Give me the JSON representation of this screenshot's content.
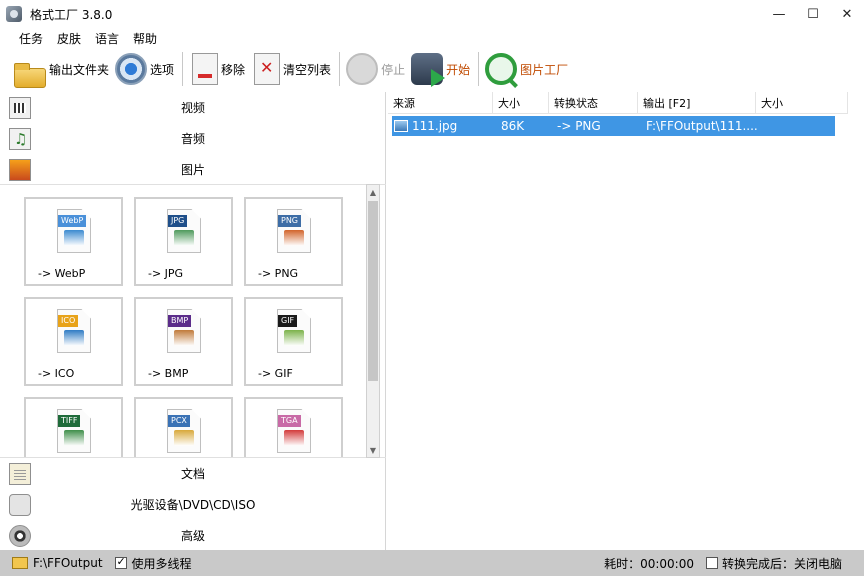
{
  "window": {
    "title": "格式工厂 3.8.0",
    "controls": {
      "minimize": "—",
      "maximize": "☐",
      "close": "✕"
    }
  },
  "menu": [
    "任务",
    "皮肤",
    "语言",
    "帮助"
  ],
  "toolbar": {
    "output_folder": "输出文件夹",
    "options": "选项",
    "remove": "移除",
    "clear_list": "清空列表",
    "stop": "停止",
    "start": "开始",
    "picture_factory": "图片工厂"
  },
  "categories": {
    "video": "视频",
    "audio": "音频",
    "picture": "图片",
    "document": "文档",
    "dvd": "光驱设备\\DVD\\CD\\ISO",
    "advanced": "高级"
  },
  "picture_tiles": [
    {
      "label": "-> WebP",
      "badge": "WebP",
      "badge_color": "#4a90d9"
    },
    {
      "label": "-> JPG",
      "badge": "JPG",
      "badge_color": "#1f4f8a"
    },
    {
      "label": "-> PNG",
      "badge": "PNG",
      "badge_color": "#3d6da6"
    },
    {
      "label": "-> ICO",
      "badge": "ICO",
      "badge_color": "#e8a31a"
    },
    {
      "label": "-> BMP",
      "badge": "BMP",
      "badge_color": "#5b2c8a"
    },
    {
      "label": "-> GIF",
      "badge": "GIF",
      "badge_color": "#1a1a1a"
    },
    {
      "label": "",
      "badge": "TIFF",
      "badge_color": "#1f6b3a"
    },
    {
      "label": "",
      "badge": "PCX",
      "badge_color": "#3a72b5"
    },
    {
      "label": "",
      "badge": "TGA",
      "badge_color": "#c86aa6"
    }
  ],
  "task_list": {
    "columns": [
      "来源",
      "大小",
      "转换状态",
      "输出 [F2]",
      "大小"
    ],
    "rows": [
      {
        "source": "111.jpg",
        "size": "86K",
        "status": "-> PNG",
        "output": "F:\\FFOutput\\111....",
        "out_size": ""
      }
    ]
  },
  "statusbar": {
    "output_path": "F:\\FFOutput",
    "multithread_label": "使用多线程",
    "multithread_checked": true,
    "elapsed": "耗时：00:00:00",
    "after_done_label": "转换完成后：关闭电脑",
    "after_done_checked": false
  }
}
